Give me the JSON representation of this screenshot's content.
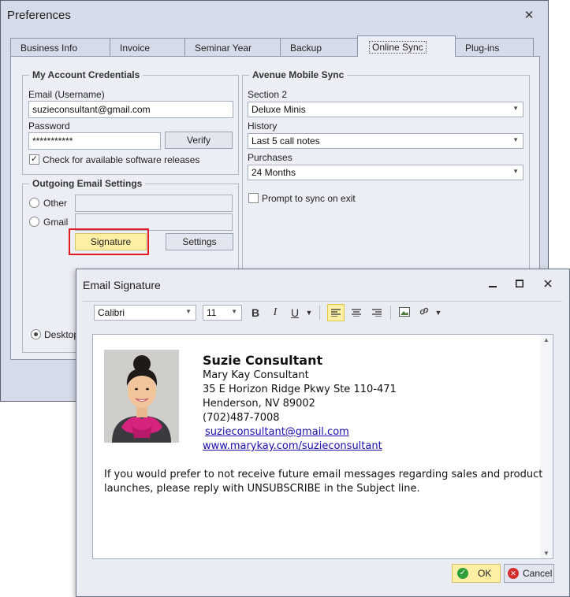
{
  "preferences": {
    "title": "Preferences",
    "close_glyph": "✕",
    "tabs": [
      "Business Info",
      "Invoice",
      "Seminar Year",
      "Backup",
      "Online Sync",
      "Plug-ins"
    ],
    "active_tab": "Online Sync",
    "credentials": {
      "group_title": "My Account Credentials",
      "email_label": "Email (Username)",
      "email_value": "suzieconsultant@gmail.com",
      "password_label": "Password",
      "password_value": "***********",
      "verify_label": "Verify",
      "check_updates_label": "Check for available software releases",
      "check_updates_checked": true
    },
    "outgoing": {
      "group_title": "Outgoing Email Settings",
      "other_label": "Other",
      "gmail_label": "Gmail",
      "signature_label": "Signature",
      "settings_label": "Settings",
      "desktop_label": "Desktop"
    },
    "mobile_sync": {
      "group_title": "Avenue Mobile Sync",
      "section2_label": "Section 2",
      "section2_value": "Deluxe Minis",
      "history_label": "History",
      "history_value": "Last 5 call notes",
      "purchases_label": "Purchases",
      "purchases_value": "24 Months",
      "prompt_label": "Prompt to sync on exit",
      "prompt_checked": false
    }
  },
  "signature_dialog": {
    "title": "Email Signature",
    "toolbar": {
      "font_value": "Calibri",
      "size_value": "11",
      "bold_glyph": "B",
      "italic_glyph": "I",
      "underline_glyph": "U"
    },
    "content": {
      "name": "Suzie Consultant",
      "lines": [
        "Mary Kay Consultant",
        "35 E Horizon Ridge Pkwy Ste 110-471",
        "Henderson, NV 89002",
        "(702)487-7008"
      ],
      "email_link": "suzieconsultant@gmail.com",
      "web_link": "www.marykay.com/suzieconsultant",
      "footer_line1": "If you would prefer to not receive future email messages regarding sales and product",
      "footer_line2": "launches, please reply with UNSUBSCRIBE in the Subject line."
    },
    "ok_label": "OK",
    "cancel_label": "Cancel"
  },
  "colors": {
    "highlight": "#e01b24",
    "signature_button": "#fdf0a5",
    "ok_button": "#fdf0a5",
    "ok_icon": "#2e9e3b",
    "cancel_icon": "#d62d2d"
  }
}
